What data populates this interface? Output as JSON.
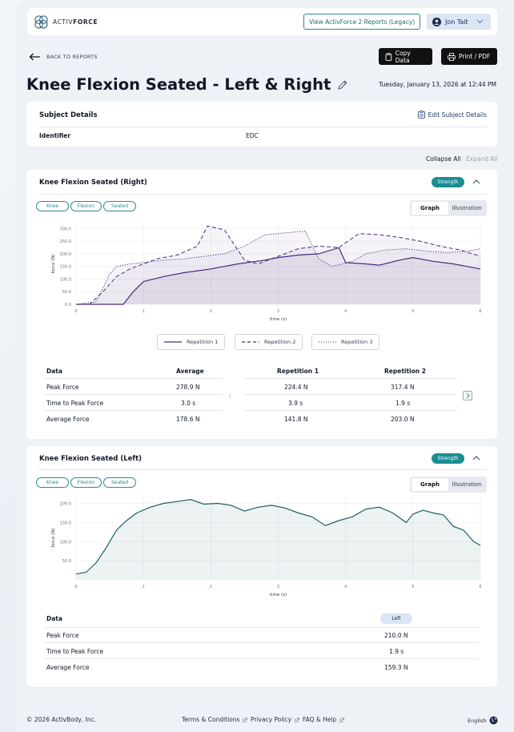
{
  "header": {
    "logo_text_light": "ACTIV",
    "logo_text_bold": "FORCE",
    "legacy_button": "View ActivForce 2 Reports (Legacy)",
    "user_name": "Jon Tait"
  },
  "nav": {
    "back_label": "BACK TO REPORTS",
    "copy_label": "Copy Data",
    "print_label": "Print / PDF"
  },
  "page": {
    "title": "Knee Flexion Seated - Left & Right",
    "datetime": "Tuesday, January 13, 2026 at 12:44 PM"
  },
  "subject": {
    "title": "Subject Details",
    "edit_label": "Edit Subject Details",
    "identifier_label": "Identifier",
    "identifier_value": "EDC"
  },
  "controls": {
    "collapse_all": "Collapse All",
    "expand_all": "Expand All"
  },
  "right_card": {
    "title": "Knee Flexion Seated (Right)",
    "badge": "Strength",
    "tags": [
      "Knee",
      "Flexion",
      "Seated"
    ],
    "toggle": [
      "Graph",
      "Illustration"
    ],
    "legend": [
      "Repetition 1",
      "Repetition 2",
      "Repetition 3"
    ],
    "table": {
      "headers": [
        "Data",
        "Average",
        "Repetition 1",
        "Repetition 2"
      ],
      "rows": [
        [
          "Peak Force",
          "278.9 N",
          "224.4 N",
          "317.4 N"
        ],
        [
          "Time to Peak Force",
          "3.0 s",
          "3.9 s",
          "1.9 s"
        ],
        [
          "Average Force",
          "178.6 N",
          "141.8 N",
          "203.0 N"
        ]
      ]
    }
  },
  "left_card": {
    "title": "Knee Flexion Seated (Left)",
    "badge": "Strength",
    "tags": [
      "Knee",
      "Flexion",
      "Seated"
    ],
    "toggle": [
      "Graph",
      "Illustration"
    ],
    "table": {
      "headers": [
        "Data",
        "Left"
      ],
      "rows": [
        [
          "Peak Force",
          "210.0 N"
        ],
        [
          "Time to Peak Force",
          "1.9 s"
        ],
        [
          "Average Force",
          "159.3 N"
        ]
      ]
    }
  },
  "footer": {
    "copyright": "© 2026 ActivBody, Inc.",
    "links": [
      "Terms & Conditions",
      "Privacy Policy",
      "FAQ & Help"
    ],
    "language": "English"
  },
  "colors": {
    "accent": "#1b8c93",
    "series_right": "#4a2d7f",
    "series_left": "#1d5f66"
  },
  "chart_data": [
    {
      "type": "line",
      "xlabel": "time (s)",
      "ylabel": "force (N)",
      "xlim": [
        0,
        6
      ],
      "ylim": [
        0,
        320
      ],
      "xticks": [
        "0",
        "1",
        "2",
        "3",
        "4",
        "5",
        "6"
      ],
      "yticks": [
        "0.0",
        "50.0",
        "100.0",
        "150.0",
        "200.0",
        "250.0",
        "300.0"
      ],
      "series": [
        {
          "name": "Repetition 1",
          "style": "solid",
          "x": [
            0,
            0.35,
            0.7,
            0.85,
            1.0,
            1.3,
            1.6,
            2.0,
            2.4,
            2.8,
            3.0,
            3.3,
            3.6,
            3.9,
            4.0,
            4.3,
            4.5,
            4.8,
            5.0,
            5.3,
            5.6,
            5.8,
            6.0
          ],
          "y": [
            0,
            0,
            0,
            50,
            90,
            110,
            125,
            140,
            160,
            175,
            185,
            195,
            200,
            224,
            165,
            160,
            155,
            175,
            185,
            170,
            160,
            150,
            140
          ]
        },
        {
          "name": "Repetition 2",
          "style": "dashed",
          "x": [
            0,
            0.2,
            0.4,
            0.6,
            0.8,
            1.0,
            1.2,
            1.5,
            1.8,
            1.95,
            2.2,
            2.5,
            2.7,
            3.0,
            3.3,
            3.6,
            3.9,
            4.2,
            4.5,
            4.8,
            5.1,
            5.4,
            5.7,
            6.0
          ],
          "y": [
            0,
            0,
            50,
            110,
            140,
            160,
            180,
            195,
            230,
            310,
            295,
            175,
            160,
            190,
            220,
            230,
            225,
            280,
            275,
            265,
            250,
            230,
            215,
            190
          ]
        },
        {
          "name": "Repetition 3",
          "style": "dotted",
          "x": [
            0,
            0.3,
            0.5,
            0.6,
            0.8,
            1.0,
            1.3,
            1.6,
            1.9,
            2.2,
            2.5,
            2.8,
            3.0,
            3.2,
            3.4,
            3.6,
            3.8,
            4.1,
            4.3,
            4.6,
            4.9,
            5.2,
            5.5,
            5.8,
            6.0
          ],
          "y": [
            0,
            10,
            120,
            150,
            160,
            165,
            175,
            180,
            190,
            200,
            230,
            275,
            280,
            285,
            290,
            180,
            150,
            170,
            200,
            215,
            220,
            210,
            205,
            210,
            220
          ]
        }
      ]
    },
    {
      "type": "line",
      "xlabel": "time (s)",
      "ylabel": "force (N)",
      "xlim": [
        0,
        6
      ],
      "ylim": [
        0,
        220
      ],
      "xticks": [
        "0",
        "1",
        "2",
        "3",
        "4",
        "5",
        "6"
      ],
      "yticks": [
        "50.0",
        "100.0",
        "150.0",
        "200.0"
      ],
      "series": [
        {
          "name": "Left",
          "style": "solid",
          "x": [
            0,
            0.15,
            0.3,
            0.45,
            0.6,
            0.75,
            0.9,
            1.1,
            1.3,
            1.5,
            1.7,
            1.9,
            2.1,
            2.3,
            2.5,
            2.7,
            2.9,
            3.1,
            3.3,
            3.5,
            3.7,
            3.9,
            4.1,
            4.3,
            4.5,
            4.7,
            4.9,
            5.0,
            5.15,
            5.3,
            5.45,
            5.6,
            5.75,
            5.9,
            6.0
          ],
          "y": [
            15,
            20,
            45,
            85,
            130,
            155,
            175,
            190,
            200,
            205,
            210,
            198,
            200,
            195,
            180,
            190,
            195,
            188,
            175,
            165,
            142,
            155,
            165,
            185,
            190,
            175,
            150,
            172,
            182,
            175,
            170,
            140,
            130,
            100,
            90
          ]
        }
      ]
    }
  ]
}
